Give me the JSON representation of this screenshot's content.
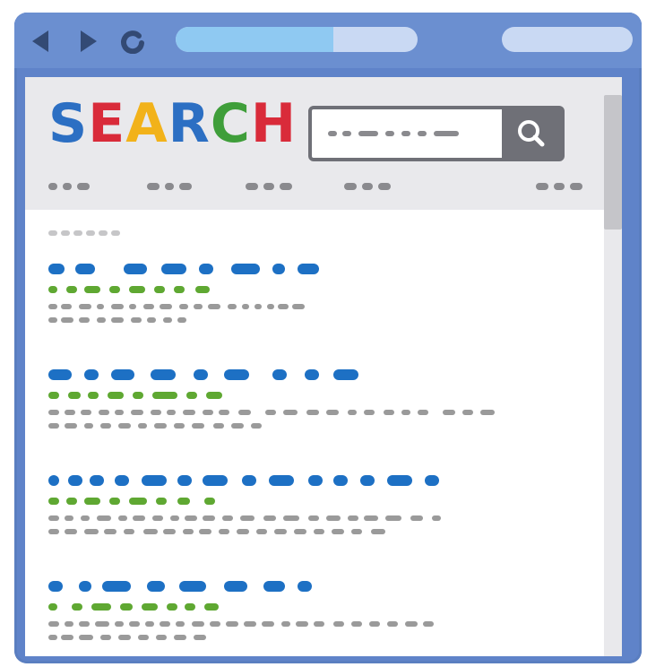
{
  "logo": {
    "letters": [
      {
        "char": "S",
        "color": "#2c6fc3"
      },
      {
        "char": "E",
        "color": "#d92b3a"
      },
      {
        "char": "A",
        "color": "#f2b21a"
      },
      {
        "char": "R",
        "color": "#2c6fc3"
      },
      {
        "char": "C",
        "color": "#3f9e3a"
      },
      {
        "char": "H",
        "color": "#d92b3a"
      }
    ]
  },
  "icons": {
    "back": "back-arrow-icon",
    "forward": "forward-arrow-icon",
    "reload": "reload-icon",
    "search": "magnifier-icon"
  },
  "colors": {
    "title_link": "#1d70c4",
    "url_line": "#5fa832",
    "snippet": "#9a9a9a",
    "nav_dots": "#8a8a8e",
    "browser_frame": "#6b8fd0",
    "address_progress": "#8fc9f2"
  },
  "address_bar": {
    "progress_fraction": 0.65
  },
  "results_count": 4
}
